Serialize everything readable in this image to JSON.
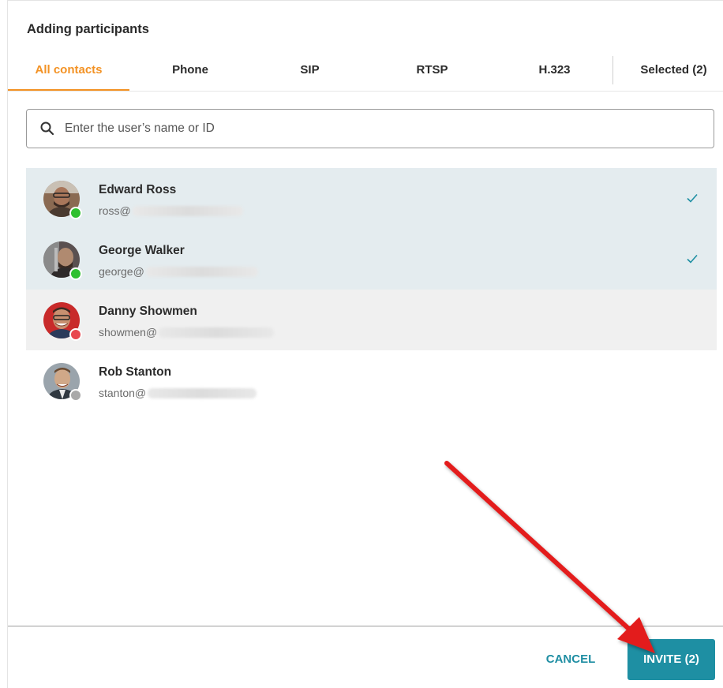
{
  "dialog": {
    "title": "Adding participants",
    "tabs": [
      {
        "label": "All contacts",
        "active": true
      },
      {
        "label": "Phone",
        "active": false
      },
      {
        "label": "SIP",
        "active": false
      },
      {
        "label": "RTSP",
        "active": false
      },
      {
        "label": "H.323",
        "active": false
      },
      {
        "label": "Selected (2)",
        "active": false
      }
    ],
    "search": {
      "placeholder": "Enter the user’s name or ID",
      "value": ""
    },
    "contacts": [
      {
        "name": "Edward Ross",
        "email_prefix": "ross@",
        "status": "online",
        "selected": true
      },
      {
        "name": "George Walker",
        "email_prefix": "george@",
        "status": "online",
        "selected": true
      },
      {
        "name": "Danny Showmen",
        "email_prefix": "showmen@",
        "status": "busy",
        "selected": false
      },
      {
        "name": "Rob Stanton",
        "email_prefix": "stanton@",
        "status": "offline",
        "selected": false
      }
    ],
    "buttons": {
      "cancel": "CANCEL",
      "invite": "INVITE (2)"
    }
  },
  "colors": {
    "accent_orange": "#f39224",
    "teal": "#1e8fa3",
    "selected_row": "#e4ecef",
    "hover_row": "#f0f0f0",
    "status_online": "#2fc02f",
    "status_busy": "#e8484f",
    "status_offline": "#a9a9a9",
    "annotation_arrow": "#e31e1e"
  },
  "icons": {
    "search": "search-icon",
    "check": "check-icon",
    "arrow": "red-arrow-annotation"
  }
}
